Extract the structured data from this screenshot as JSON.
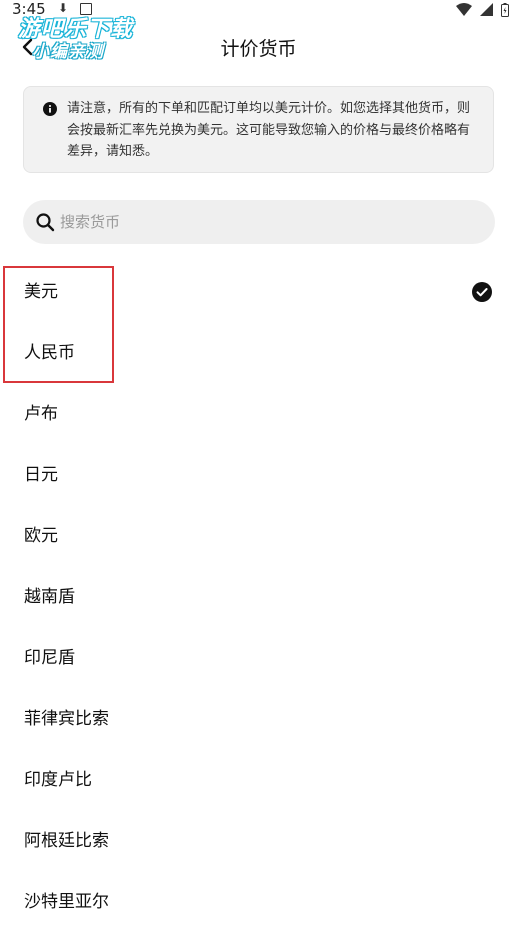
{
  "status_bar": {
    "time": "3:45"
  },
  "watermark": {
    "line1": "游吧乐下载",
    "line2": "小编亲测"
  },
  "header": {
    "title": "计价货币"
  },
  "notice": {
    "text": "请注意，所有的下单和匹配订单均以美元计价。如您选择其他货币，则会按最新汇率先兑换为美元。这可能导致您输入的价格与最终价格略有差异，请知悉。"
  },
  "search": {
    "placeholder": "搜索货币"
  },
  "currencies": [
    {
      "label": "美元",
      "selected": true
    },
    {
      "label": "人民币",
      "selected": false
    },
    {
      "label": "卢布",
      "selected": false
    },
    {
      "label": "日元",
      "selected": false
    },
    {
      "label": "欧元",
      "selected": false
    },
    {
      "label": "越南盾",
      "selected": false
    },
    {
      "label": "印尼盾",
      "selected": false
    },
    {
      "label": "菲律宾比索",
      "selected": false
    },
    {
      "label": "印度卢比",
      "selected": false
    },
    {
      "label": "阿根廷比索",
      "selected": false
    },
    {
      "label": "沙特里亚尔",
      "selected": false
    }
  ],
  "colors": {
    "highlight": "#d9373b",
    "watermark": "#1ab4d8",
    "notice_bg": "#f2f2f2",
    "search_bg": "#efefef"
  }
}
